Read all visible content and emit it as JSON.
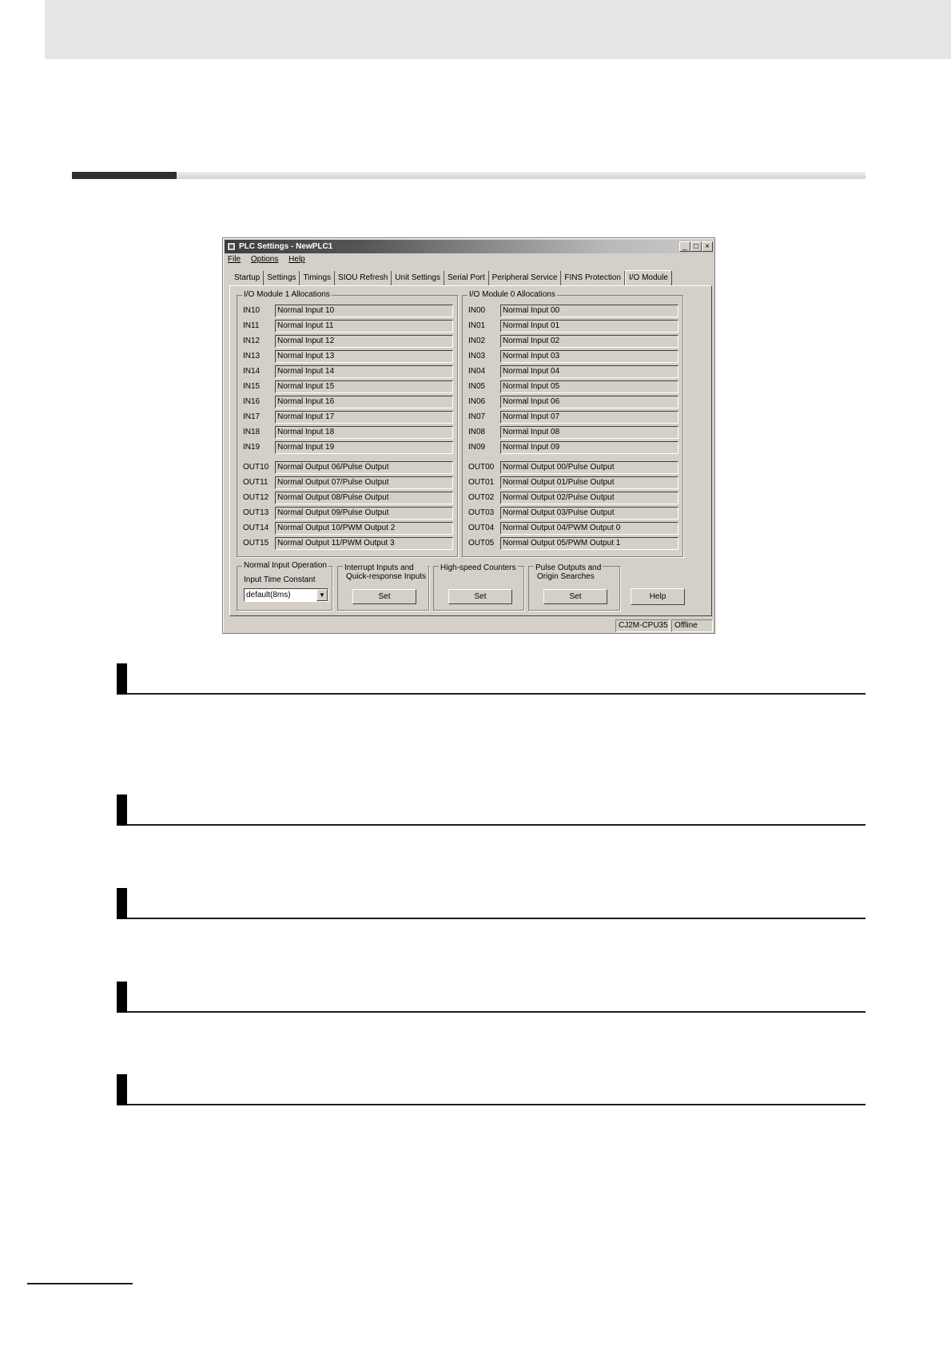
{
  "window": {
    "title": "PLC Settings - NewPLC1",
    "controls": {
      "minimize": "_",
      "maximize": "□",
      "close": "×"
    }
  },
  "menu": [
    "File",
    "Options",
    "Help"
  ],
  "tabs": [
    "Startup",
    "Settings",
    "Timings",
    "SIOU Refresh",
    "Unit Settings",
    "Serial Port",
    "Peripheral Service",
    "FINS Protection",
    "I/O Module"
  ],
  "active_tab": "I/O Module",
  "module1": {
    "title": "I/O Module 1 Allocations",
    "inputs": [
      {
        "label": "IN10",
        "value": "Normal Input 10"
      },
      {
        "label": "IN11",
        "value": "Normal Input 11"
      },
      {
        "label": "IN12",
        "value": "Normal Input 12"
      },
      {
        "label": "IN13",
        "value": "Normal Input 13"
      },
      {
        "label": "IN14",
        "value": "Normal Input 14"
      },
      {
        "label": "IN15",
        "value": "Normal Input 15"
      },
      {
        "label": "IN16",
        "value": "Normal Input 16"
      },
      {
        "label": "IN17",
        "value": "Normal Input 17"
      },
      {
        "label": "IN18",
        "value": "Normal Input 18"
      },
      {
        "label": "IN19",
        "value": "Normal Input 19"
      }
    ],
    "outputs": [
      {
        "label": "OUT10",
        "value": "Normal Output 06/Pulse Output"
      },
      {
        "label": "OUT11",
        "value": "Normal Output 07/Pulse Output"
      },
      {
        "label": "OUT12",
        "value": "Normal Output 08/Pulse Output"
      },
      {
        "label": "OUT13",
        "value": "Normal Output 09/Pulse Output"
      },
      {
        "label": "OUT14",
        "value": "Normal Output 10/PWM Output 2"
      },
      {
        "label": "OUT15",
        "value": "Normal Output 11/PWM Output 3"
      }
    ]
  },
  "module0": {
    "title": "I/O Module 0 Allocations",
    "inputs": [
      {
        "label": "IN00",
        "value": "Normal Input 00"
      },
      {
        "label": "IN01",
        "value": "Normal Input 01"
      },
      {
        "label": "IN02",
        "value": "Normal Input 02"
      },
      {
        "label": "IN03",
        "value": "Normal Input 03"
      },
      {
        "label": "IN04",
        "value": "Normal Input 04"
      },
      {
        "label": "IN05",
        "value": "Normal Input 05"
      },
      {
        "label": "IN06",
        "value": "Normal Input 06"
      },
      {
        "label": "IN07",
        "value": "Normal Input 07"
      },
      {
        "label": "IN08",
        "value": "Normal Input 08"
      },
      {
        "label": "IN09",
        "value": "Normal Input 09"
      }
    ],
    "outputs": [
      {
        "label": "OUT00",
        "value": "Normal Output 00/Pulse Output"
      },
      {
        "label": "OUT01",
        "value": "Normal Output 01/Pulse Output"
      },
      {
        "label": "OUT02",
        "value": "Normal Output 02/Pulse Output"
      },
      {
        "label": "OUT03",
        "value": "Normal Output 03/Pulse Output"
      },
      {
        "label": "OUT04",
        "value": "Normal Output 04/PWM Output 0"
      },
      {
        "label": "OUT05",
        "value": "Normal Output 05/PWM Output 1"
      }
    ]
  },
  "normal_input": {
    "title": "Normal Input Operation",
    "label": "Input Time Constant",
    "value": "default(8ms)"
  },
  "interrupt": {
    "title_line1": "Interrupt Inputs and",
    "title_line2": "Quick-response Inputs",
    "button": "Set"
  },
  "hsc": {
    "title": "High-speed Counters",
    "button": "Set"
  },
  "pulse": {
    "title_line1": "Pulse Outputs and",
    "title_line2": "Origin Searches",
    "button": "Set"
  },
  "help_button": "Help",
  "status": {
    "model": "CJ2M-CPU35",
    "mode": "Offline"
  }
}
